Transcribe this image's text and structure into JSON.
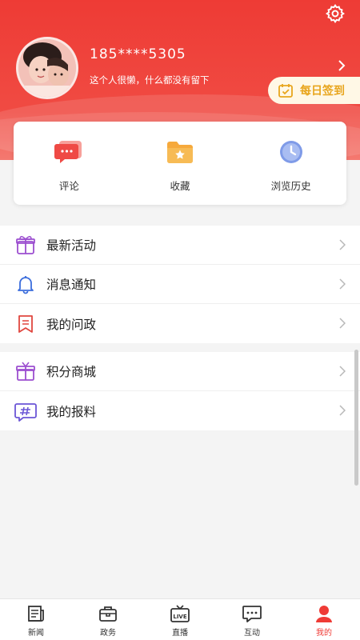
{
  "profile": {
    "username": "185****5305",
    "bio": "这个人很懒，什么都没有留下",
    "signin_label": "每日签到"
  },
  "quick_actions": [
    {
      "label": "评论",
      "icon": "comment-icon"
    },
    {
      "label": "收藏",
      "icon": "favorite-folder-icon"
    },
    {
      "label": "浏览历史",
      "icon": "history-clock-icon"
    }
  ],
  "menu_group1": [
    {
      "label": "最新活动",
      "icon": "gift-icon"
    },
    {
      "label": "消息通知",
      "icon": "bell-icon"
    },
    {
      "label": "我的问政",
      "icon": "bookmark-icon"
    }
  ],
  "menu_group2": [
    {
      "label": "积分商城",
      "icon": "gift-box-icon"
    },
    {
      "label": "我的报料",
      "icon": "hashtag-icon"
    }
  ],
  "tabs": [
    {
      "label": "新闻",
      "icon": "newspaper-icon"
    },
    {
      "label": "政务",
      "icon": "briefcase-icon"
    },
    {
      "label": "直播",
      "icon": "live-tv-icon",
      "badge": "LIVE"
    },
    {
      "label": "互动",
      "icon": "chat-icon"
    },
    {
      "label": "我的",
      "icon": "user-icon",
      "active": true
    }
  ],
  "colors": {
    "header_red": "#ee3b35",
    "accent_red": "#ef3b36",
    "signin_text": "#e8a51c"
  }
}
